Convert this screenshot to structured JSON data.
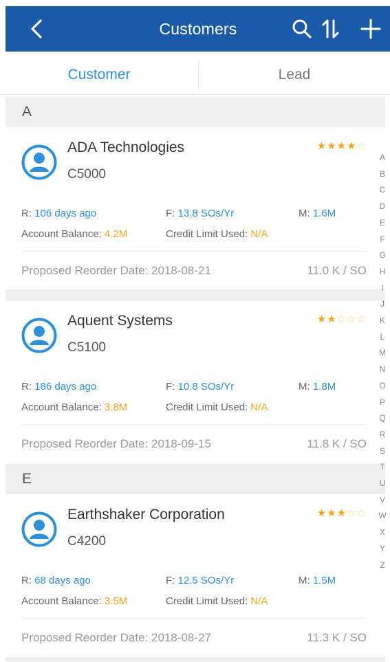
{
  "header": {
    "title": "Customers",
    "accent": "#1a5aa6"
  },
  "tabs": [
    {
      "label": "Customer",
      "active": true
    },
    {
      "label": "Lead",
      "active": false
    }
  ],
  "sections": [
    {
      "letter": "A"
    },
    {
      "letter": "E"
    }
  ],
  "customers": [
    {
      "name": "ADA Technologies",
      "code": "C5000",
      "rating": 4,
      "r_label": "R:",
      "r_value": "106 days ago",
      "f_label": "F:",
      "f_value": "13.8 SOs/Yr",
      "m_label": "M:",
      "m_value": "1.6M",
      "balance_label": "Account Balance:",
      "balance_value": "4.2M",
      "credit_label": "Credit Limit Used:",
      "credit_value": "N/A",
      "reorder": "Proposed Reorder Date: 2018-08-21",
      "spend": "11.0 K / SO"
    },
    {
      "name": "Aquent Systems",
      "code": "C5100",
      "rating": 2,
      "r_label": "R:",
      "r_value": "186 days ago",
      "f_label": "F:",
      "f_value": "10.8 SOs/Yr",
      "m_label": "M:",
      "m_value": "1.8M",
      "balance_label": "Account Balance:",
      "balance_value": "3.8M",
      "credit_label": "Credit Limit Used:",
      "credit_value": "N/A",
      "reorder": "Proposed Reorder Date: 2018-09-15",
      "spend": "11.8 K / SO"
    },
    {
      "name": "Earthshaker Corporation",
      "code": "C4200",
      "rating": 3,
      "r_label": "R:",
      "r_value": "68 days ago",
      "f_label": "F:",
      "f_value": "12.5 SOs/Yr",
      "m_label": "M:",
      "m_value": "1.5M",
      "balance_label": "Account Balance:",
      "balance_value": "3.5M",
      "credit_label": "Credit Limit Used:",
      "credit_value": "N/A",
      "reorder": "Proposed Reorder Date: 2018-08-27",
      "spend": "11.3 K / SO"
    }
  ],
  "index_letters": [
    "A",
    "B",
    "C",
    "D",
    "E",
    "F",
    "G",
    "H",
    "I",
    "J",
    "K",
    "L",
    "M",
    "N",
    "O",
    "P",
    "Q",
    "R",
    "S",
    "T",
    "U",
    "V",
    "W",
    "X",
    "Y",
    "Z"
  ],
  "icons": [
    "back-icon",
    "search-icon",
    "sort-icon",
    "add-icon",
    "avatar-icon",
    "star-icon"
  ],
  "colors": {
    "link": "#2f8fd8",
    "highlight": "#f0a823"
  }
}
